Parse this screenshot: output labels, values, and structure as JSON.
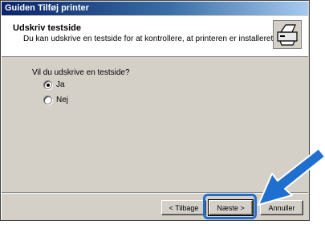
{
  "window": {
    "title": "Guiden Tilføj printer"
  },
  "header": {
    "title": "Udskriv testside",
    "subtitle": "Du kan udskrive en testside for at kontrollere, at printeren er installeret korrekt.",
    "icon": "printer-icon"
  },
  "content": {
    "question": "Vil du udskrive en testside?",
    "options": [
      {
        "label": "Ja",
        "checked": true
      },
      {
        "label": "Nej",
        "checked": false
      }
    ]
  },
  "buttons": {
    "back": "< Tilbage",
    "next": "Næste >",
    "cancel": "Annuller"
  },
  "callout": {
    "color": "#1f6fd0"
  }
}
